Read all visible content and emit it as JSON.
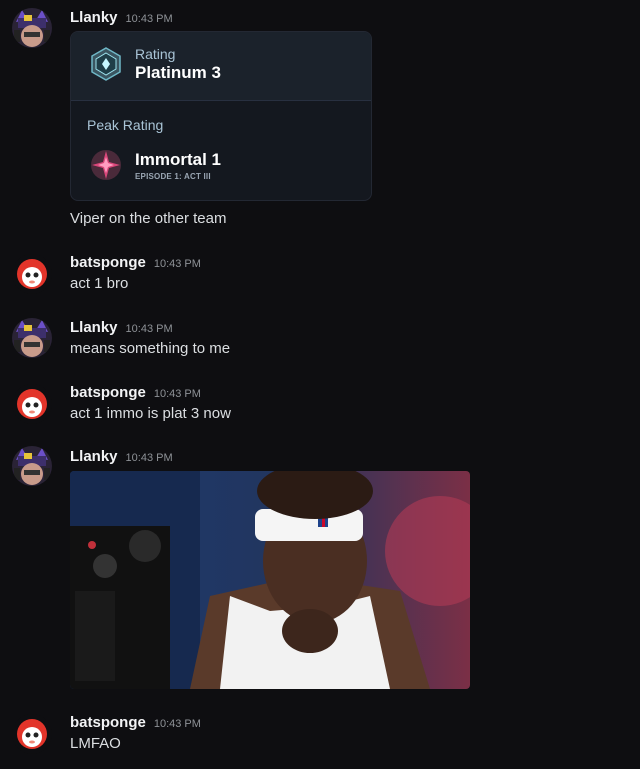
{
  "messages": [
    {
      "username": "Llanky",
      "time": "10:43 PM",
      "avatar": "llanky-avatar",
      "embed": {
        "rating_label": "Rating",
        "rating_value": "Platinum 3",
        "peak_label": "Peak Rating",
        "peak_value": "Immortal 1",
        "peak_episode": "EPISODE 1: ACT III"
      },
      "text": "Viper on the other team"
    },
    {
      "username": "batsponge",
      "time": "10:43 PM",
      "avatar": "batsponge-avatar",
      "text": "act 1 bro"
    },
    {
      "username": "Llanky",
      "time": "10:43 PM",
      "avatar": "llanky-avatar",
      "text": "means something to me"
    },
    {
      "username": "batsponge",
      "time": "10:43 PM",
      "avatar": "batsponge-avatar",
      "text": "act 1 immo is plat 3 now"
    },
    {
      "username": "Llanky",
      "time": "10:43 PM",
      "avatar": "llanky-avatar",
      "attachment": "basketball-player-gif"
    },
    {
      "username": "batsponge",
      "time": "10:43 PM",
      "avatar": "batsponge-avatar",
      "text": "LMFAO"
    }
  ],
  "colors": {
    "background": "#0e0e11",
    "username": "#f2f3f5",
    "timestamp": "#8e9297",
    "message_text": "#dbdee1",
    "embed_bg": "#14181f"
  }
}
